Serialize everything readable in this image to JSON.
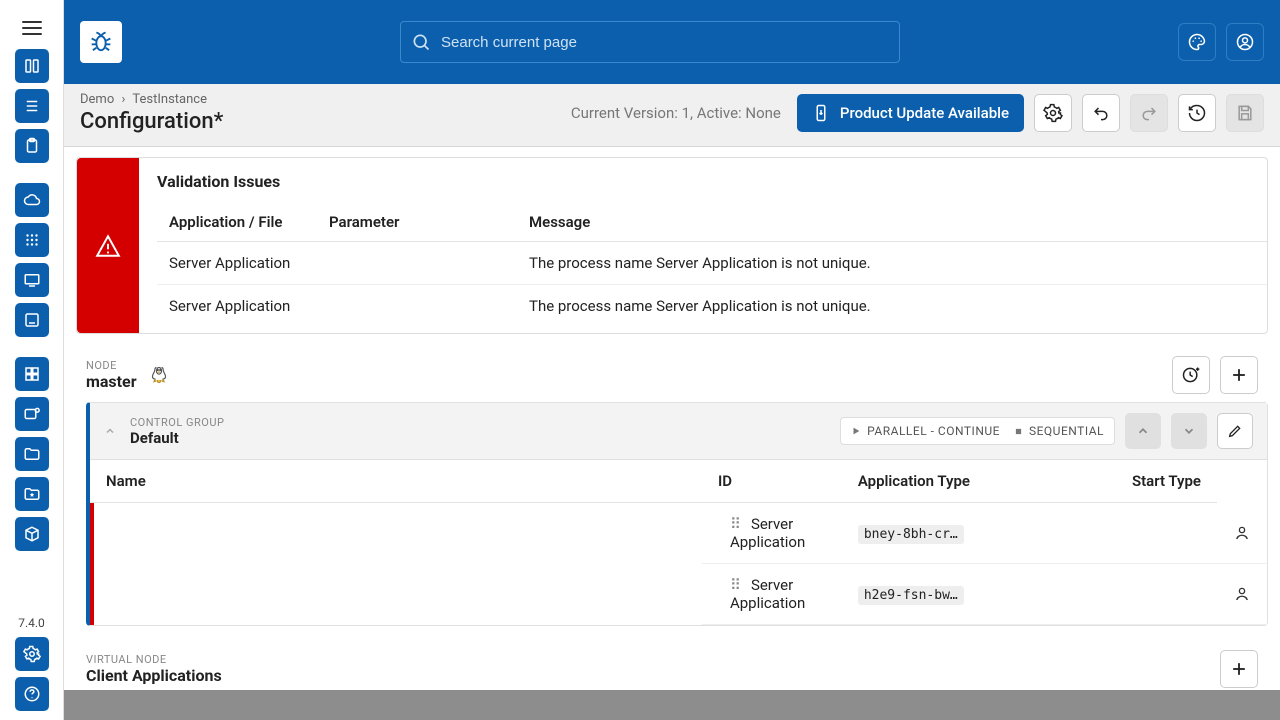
{
  "search": {
    "placeholder": "Search current page"
  },
  "version": "7.4.0",
  "breadcrumb": {
    "a": "Demo",
    "b": "TestInstance"
  },
  "page_title": "Configuration*",
  "status_line": "Current Version: 1, Active: None",
  "update_btn": "Product Update Available",
  "validation": {
    "title": "Validation Issues",
    "cols": {
      "app": "Application / File",
      "param": "Parameter",
      "msg": "Message"
    },
    "rows": [
      {
        "app": "Server Application",
        "param": "",
        "msg": "The process name Server Application is not unique."
      },
      {
        "app": "Server Application",
        "param": "",
        "msg": "The process name Server Application is not unique."
      }
    ]
  },
  "node": {
    "overline": "NODE",
    "name": "master"
  },
  "group": {
    "overline": "CONTROL GROUP",
    "name": "Default",
    "mode_parallel": "PARALLEL - CONTINUE",
    "mode_sequential": "SEQUENTIAL",
    "cols": {
      "name": "Name",
      "id": "ID",
      "type": "Application Type",
      "start": "Start Type"
    },
    "rows": [
      {
        "name": "Server Application",
        "id": "bney-8bh-cr…",
        "type": "",
        "start": "manual"
      },
      {
        "name": "Server Application",
        "id": "h2e9-fsn-bw…",
        "type": "",
        "start": "manual"
      }
    ]
  },
  "vnode": {
    "overline": "VIRTUAL NODE",
    "name": "Client Applications"
  }
}
